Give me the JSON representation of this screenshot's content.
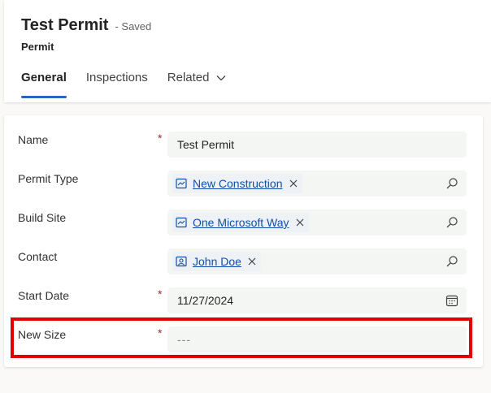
{
  "header": {
    "title": "Test Permit",
    "saved_status": "- Saved",
    "entity_name": "Permit",
    "tabs": [
      {
        "label": "General",
        "active": true
      },
      {
        "label": "Inspections",
        "active": false
      },
      {
        "label": "Related",
        "active": false
      }
    ]
  },
  "form": {
    "fields": [
      {
        "label": "Name",
        "required": "*",
        "value": "Test Permit"
      },
      {
        "label": "Permit Type",
        "required": "",
        "lookup_value": "New Construction"
      },
      {
        "label": "Build Site",
        "required": "",
        "lookup_value": "One Microsoft Way"
      },
      {
        "label": "Contact",
        "required": "",
        "lookup_value": "John Doe"
      },
      {
        "label": "Start Date",
        "required": "*",
        "value": "11/27/2024"
      },
      {
        "label": "New Size",
        "required": "*",
        "placeholder": "---"
      }
    ]
  },
  "icons": {
    "lookup_entity": "entity-record-icon",
    "contact_entity": "contact-card-icon",
    "remove": "close-icon",
    "search": "search-icon",
    "calendar": "calendar-icon",
    "tab_dropdown": "chevron-down-icon"
  },
  "colors": {
    "accent": "#2b65b7",
    "required": "#a4262c",
    "link": "#0f4fa8",
    "highlight_box": "#e30000",
    "field_bg": "#f3f6f3"
  }
}
